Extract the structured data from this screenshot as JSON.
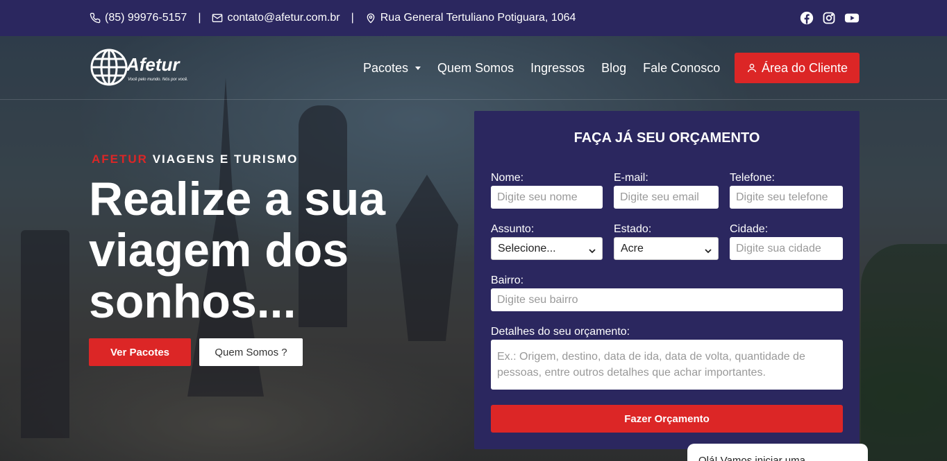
{
  "topbar": {
    "phone": "(85) 99976-5157",
    "email": "contato@afetur.com.br",
    "address": "Rua General Tertuliano Potiguara, 1064",
    "separator": "|",
    "social": [
      "facebook-icon",
      "instagram-icon",
      "youtube-icon"
    ]
  },
  "nav": {
    "logo_text": "Afetur",
    "logo_tagline": "Você pelo mundo. Nós por você.",
    "items": [
      "Pacotes",
      "Quem Somos",
      "Ingressos",
      "Blog",
      "Fale Conosco"
    ],
    "client_button": "Área do Cliente"
  },
  "hero": {
    "eyebrow_brand": "AFETUR",
    "eyebrow_rest": "VIAGENS E TURISMO",
    "headline": "Realize a sua viagem dos sonhos...",
    "btn_packages": "Ver Pacotes",
    "btn_about": "Quem Somos ?"
  },
  "form": {
    "title": "FAÇA JÁ SEU ORÇAMENTO",
    "name_label": "Nome:",
    "name_placeholder": "Digite seu nome",
    "email_label": "E-mail:",
    "email_placeholder": "Digite seu email",
    "phone_label": "Telefone:",
    "phone_placeholder": "Digite seu telefone",
    "subject_label": "Assunto:",
    "subject_value": "Selecione...",
    "state_label": "Estado:",
    "state_value": "Acre",
    "city_label": "Cidade:",
    "city_placeholder": "Digite sua cidade",
    "district_label": "Bairro:",
    "district_placeholder": "Digite seu bairro",
    "details_label": "Detalhes do seu orçamento:",
    "details_placeholder": "Ex.: Origem, destino, data de ida, data de volta, quantidade de pessoas, entre outros detalhes que achar importantes.",
    "submit": "Fazer Orçamento"
  },
  "chat": {
    "text": "Olá! Vamos iniciar uma"
  },
  "colors": {
    "primary_navy": "#2b275f",
    "accent_red": "#dc2626"
  }
}
